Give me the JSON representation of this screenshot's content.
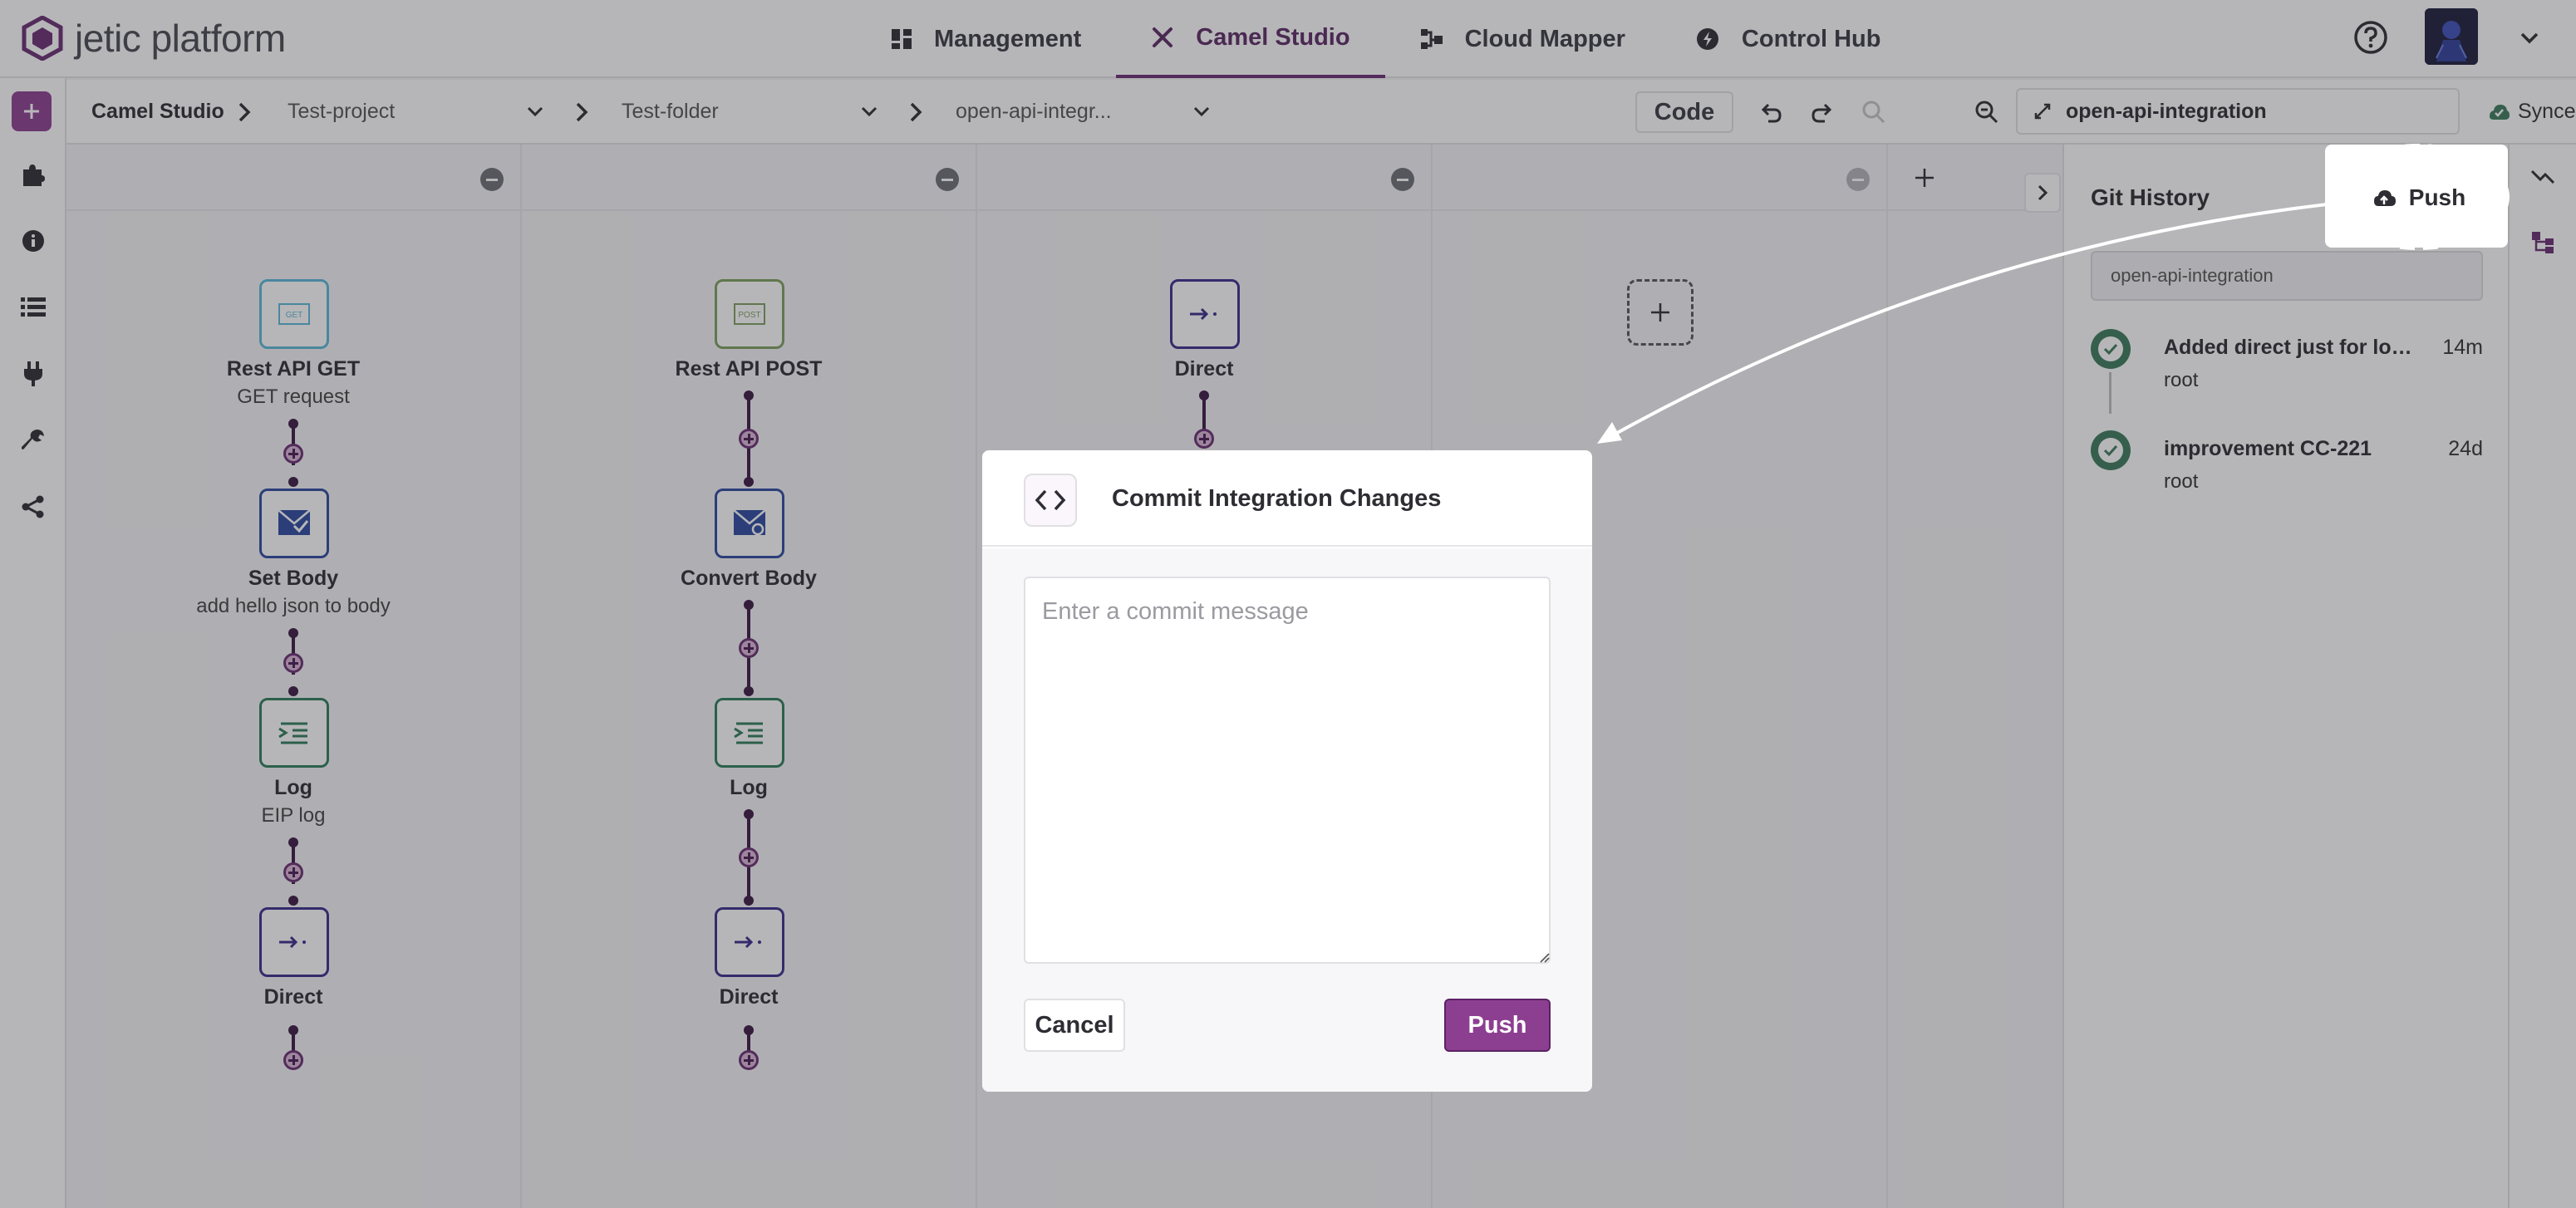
{
  "app": {
    "logo_text": "jetic platform"
  },
  "nav": {
    "tabs": [
      {
        "label": "Management",
        "icon": "dashboard-icon"
      },
      {
        "label": "Camel Studio",
        "icon": "tools-icon",
        "active": true
      },
      {
        "label": "Cloud Mapper",
        "icon": "mapper-icon"
      },
      {
        "label": "Control Hub",
        "icon": "hub-icon"
      }
    ]
  },
  "breadcrumb": {
    "root": "Camel Studio",
    "project": "Test-project",
    "folder": "Test-folder",
    "integration": "open-api-integr..."
  },
  "toolbar": {
    "code_label": "Code",
    "integration_name": "open-api-integration",
    "sync_status": "Synced"
  },
  "routes": [
    {
      "steps": [
        {
          "label": "Rest API GET",
          "sublabel": "GET request",
          "icon": "rest-get-icon",
          "badge": "GET"
        },
        {
          "label": "Set Body",
          "sublabel": "add hello json to body",
          "icon": "set-body-icon"
        },
        {
          "label": "Log",
          "sublabel": "EIP log",
          "icon": "log-icon"
        },
        {
          "label": "Direct",
          "sublabel": "",
          "icon": "direct-icon"
        }
      ]
    },
    {
      "steps": [
        {
          "label": "Rest API POST",
          "sublabel": "",
          "icon": "rest-post-icon",
          "badge": "POST"
        },
        {
          "label": "Convert Body",
          "sublabel": "",
          "icon": "convert-body-icon"
        },
        {
          "label": "Log",
          "sublabel": "",
          "icon": "log-icon"
        },
        {
          "label": "Direct",
          "sublabel": "",
          "icon": "direct-icon"
        }
      ]
    },
    {
      "steps": [
        {
          "label": "Direct",
          "sublabel": "",
          "icon": "direct-icon"
        }
      ]
    }
  ],
  "git": {
    "title": "Git History",
    "push_label": "Push",
    "branch": "open-api-integration",
    "commits": [
      {
        "message": "Added direct just for logging",
        "user": "root",
        "age": "14m"
      },
      {
        "message": "improvement CC-221",
        "user": "root",
        "age": "24d"
      }
    ]
  },
  "modal": {
    "title": "Commit Integration Changes",
    "placeholder": "Enter a commit message",
    "value": "",
    "cancel_label": "Cancel",
    "push_label": "Push"
  },
  "colors": {
    "brand": "#8c3f90",
    "brand_dark": "#5b2a64",
    "success": "#3c7b5c",
    "get_blue": "#5bb8d8",
    "post_green": "#7fa060",
    "set_blue": "#2c4aa0",
    "log_green": "#2e7d5a",
    "direct_purple": "#3a2c8c"
  }
}
